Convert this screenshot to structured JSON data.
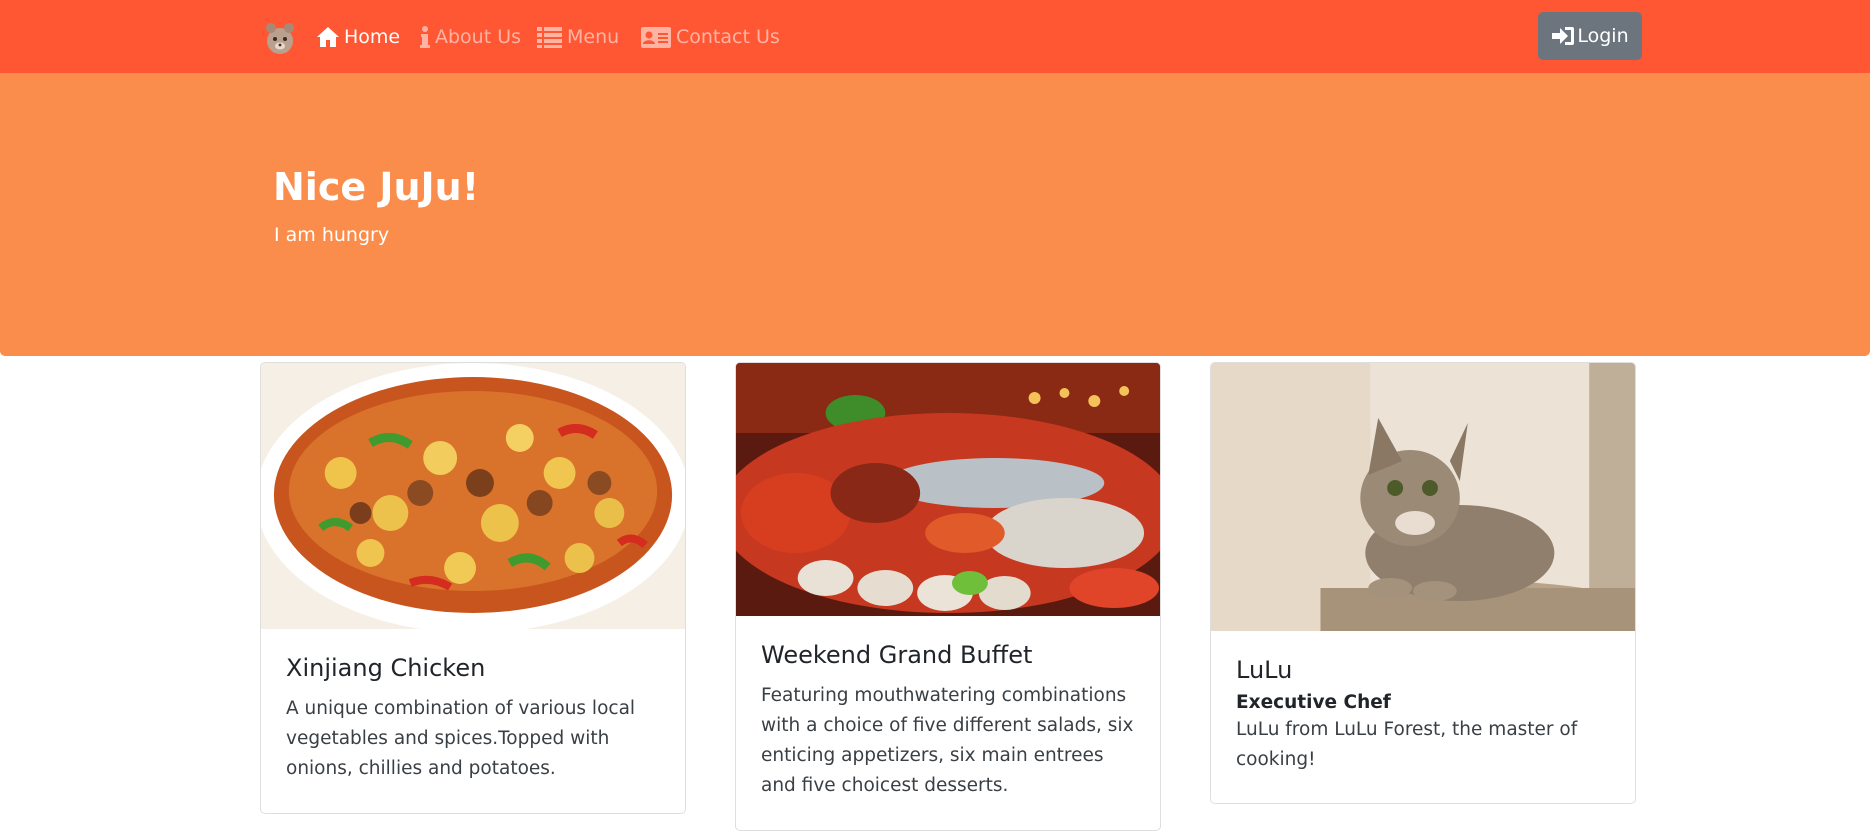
{
  "navbar": {
    "brand_icon": "bear-logo-icon",
    "items": [
      {
        "label": "Home",
        "icon": "home-icon",
        "active": true
      },
      {
        "label": "About Us",
        "icon": "info-icon",
        "active": false
      },
      {
        "label": "Menu",
        "icon": "list-icon",
        "active": false
      },
      {
        "label": "Contact Us",
        "icon": "contact-card-icon",
        "active": false
      }
    ],
    "login": {
      "label": "Login",
      "icon": "sign-in-icon"
    }
  },
  "hero": {
    "title": "Nice JuJu!",
    "subtitle": "I am hungry"
  },
  "cards": [
    {
      "title": "Xinjiang Chicken",
      "text": "A unique combination of various local vegetables and spices.Topped with onions, chillies and potatoes.",
      "image": "chicken-dish-photo"
    },
    {
      "title": "Weekend Grand Buffet",
      "text": "Featuring mouthwatering combinations with a choice of five different salads, six enticing appetizers, six main entrees and five choicest desserts.",
      "image": "seafood-buffet-photo"
    },
    {
      "title": "LuLu",
      "subtitle": "Executive Chef",
      "text": "LuLu from LuLu Forest, the master of cooking!",
      "image": "cat-photo"
    }
  ],
  "colors": {
    "navbar": "#FF5733",
    "hero": "#FA8D4B",
    "login_button": "#6c757d"
  }
}
